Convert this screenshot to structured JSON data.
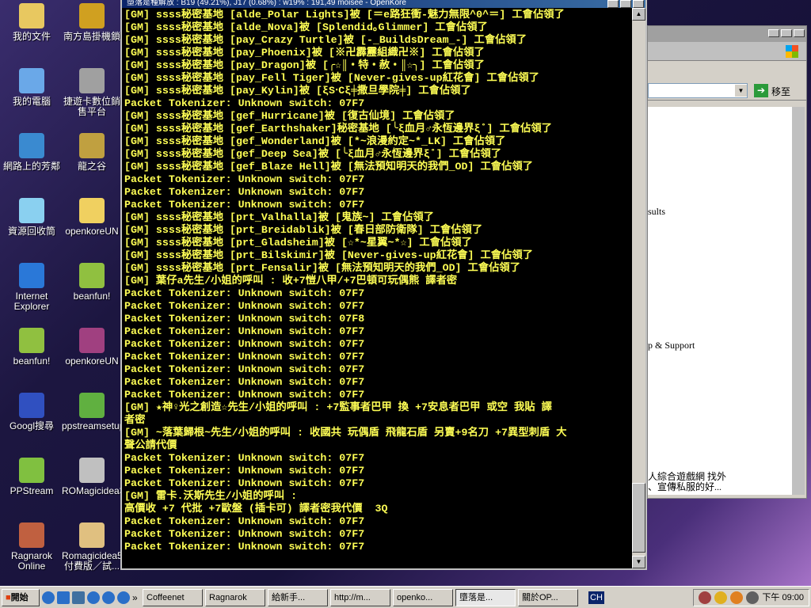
{
  "desktop_icons": [
    {
      "label": "我的文件",
      "color": "#e8c860"
    },
    {
      "label": "南方島掛機鎖",
      "color": "#d0a020"
    },
    {
      "label": "我的電腦",
      "color": "#6aa8e8"
    },
    {
      "label": "捷遊卡數位銷售平台",
      "color": "#a0a0a0"
    },
    {
      "label": "網路上的芳鄰",
      "color": "#3a8ad0"
    },
    {
      "label": "龍之谷",
      "color": "#c0a040"
    },
    {
      "label": "資源回收筒",
      "color": "#8ad0f0"
    },
    {
      "label": "openkoreUN",
      "color": "#f0d060"
    },
    {
      "label": "Internet Explorer",
      "color": "#2a78d8"
    },
    {
      "label": "beanfun!",
      "color": "#90c040"
    },
    {
      "label": "beanfun!",
      "color": "#90c040"
    },
    {
      "label": "openkoreUN",
      "color": "#a04080"
    },
    {
      "label": "Googl搜尋",
      "color": "#3050c0"
    },
    {
      "label": "ppstreamsetup",
      "color": "#60b040"
    },
    {
      "label": "PPStream",
      "color": "#80c040"
    },
    {
      "label": "ROMagicidea3",
      "color": "#c0c0c0"
    },
    {
      "label": "Ragnarok Online",
      "color": "#c06040"
    },
    {
      "label": "Romagicidea5付費版／試...",
      "color": "#e0c080"
    }
  ],
  "console": {
    "title": "墮落是種解放 : B19 (49.21%), J17 (0.68%) : w19% : 191,49 moisee - OpenKore",
    "lines": [
      "[GM] ssss秘密基地 [alde_Polar Lights]被 [＝e路狂衝-魅力無限^0^＝] 工會佔領了",
      "[GM] ssss秘密基地 [alde_Nova]被 [Splendid｡Glimmer] 工會佔領了",
      "[GM] ssss秘密基地 [pay_Crazy Turtle]被 [-_BuildsDream_-] 工會佔領了",
      "[GM] ssss秘密基地 [pay_Phoenix]被 [※卍霹靂組織卍※] 工會佔領了",
      "[GM] ssss秘密基地 [pay_Dragon]被 [╭☆║‧特‧赦‧║☆╮] 工會佔領了",
      "[GM] ssss秘密基地 [pay_Fell Tiger]被 [Never-gives-up紅花會] 工會佔領了",
      "[GM] ssss秘密基地 [pay_Kylin]被 [ξS‧Cξ╪撒旦學院╪] 工會佔領了",
      "Packet Tokenizer: Unknown switch: 07F7",
      "[GM] ssss秘密基地 [gef_Hurricane]被 [復古仙境] 工會佔領了",
      "[GM] ssss秘密基地 [gef_Earthshaker]秘密基地 [╰ξ血月♂永恆邊界ξ˚] 工會佔領了",
      "[GM] ssss秘密基地 [gef_Wonderland]被 [*~浪漫約定~*_LK] 工會佔領了",
      "[GM] ssss秘密基地 [gef_Deep Sea]被 [╰ξ血月♂永恆邊界ξ˚] 工會佔領了",
      "[GM] ssss秘密基地 [gef_Blaze Hell]被 [無法預知明天的我們_OD] 工會佔領了",
      "Packet Tokenizer: Unknown switch: 07F7",
      "Packet Tokenizer: Unknown switch: 07F7",
      "Packet Tokenizer: Unknown switch: 07F7",
      "[GM] ssss秘密基地 [prt_Valhalla]被 [鬼族~] 工會佔領了",
      "[GM] ssss秘密基地 [prt_Breidablik]被 [春日部防衛隊] 工會佔領了",
      "[GM] ssss秘密基地 [prt_Gladsheim]被 [☆*~星翼~*☆] 工會佔領了",
      "[GM] ssss秘密基地 [prt_Bilskimir]被 [Never-gives-up紅花會] 工會佔領了",
      "[GM] ssss秘密基地 [prt_Fensalir]被 [無法預知明天的我們_OD] 工會佔領了",
      "[GM] 葉仔a先生/小姐的呼叫 : 收+7愷八甲/+7巴頓可玩偶熊 譯者密",
      "Packet Tokenizer: Unknown switch: 07F7",
      "Packet Tokenizer: Unknown switch: 07F7",
      "Packet Tokenizer: Unknown switch: 07F8",
      "Packet Tokenizer: Unknown switch: 07F7",
      "Packet Tokenizer: Unknown switch: 07F7",
      "Packet Tokenizer: Unknown switch: 07F7",
      "Packet Tokenizer: Unknown switch: 07F7",
      "Packet Tokenizer: Unknown switch: 07F7",
      "Packet Tokenizer: Unknown switch: 07F7",
      "[GM] ★神♀光之創造☆先生/小姐的呼叫 : +7監事者巴甲 換 +7安息者巴甲 或空 我貼 譯",
      "者密",
      "[GM] ~落葉歸根~先生/小姐的呼叫 : 收國共 玩偶盾 飛龍石盾 另賣+9名刀 +7異型刺盾 大",
      "聲公請代價",
      "Packet Tokenizer: Unknown switch: 07F7",
      "Packet Tokenizer: Unknown switch: 07F7",
      "Packet Tokenizer: Unknown switch: 07F7",
      "[GM] 雷卡.沃斯先生/小姐的呼叫 :",
      "高價收 +7 代批 +7歐盤 (插卡可) 譯者密我代價  3Q",
      "Packet Tokenizer: Unknown switch: 07F7",
      "Packet Tokenizer: Unknown switch: 07F7",
      "Packet Tokenizer: Unknown switch: 07F7"
    ]
  },
  "ie": {
    "go_label": "移至",
    "snippets": [
      "sults",
      "p & Support",
      "人綜合遊戲網 找外",
      "、宣傳私服的好..."
    ]
  },
  "taskbar": {
    "start": "開始",
    "items": [
      "Coffeenet",
      "Ragnarok",
      "給新手...",
      "http://m...",
      "openko...",
      "墮落是...",
      "關於OP..."
    ],
    "active": 5,
    "lang": "CH",
    "clock": "下午 09:00"
  }
}
